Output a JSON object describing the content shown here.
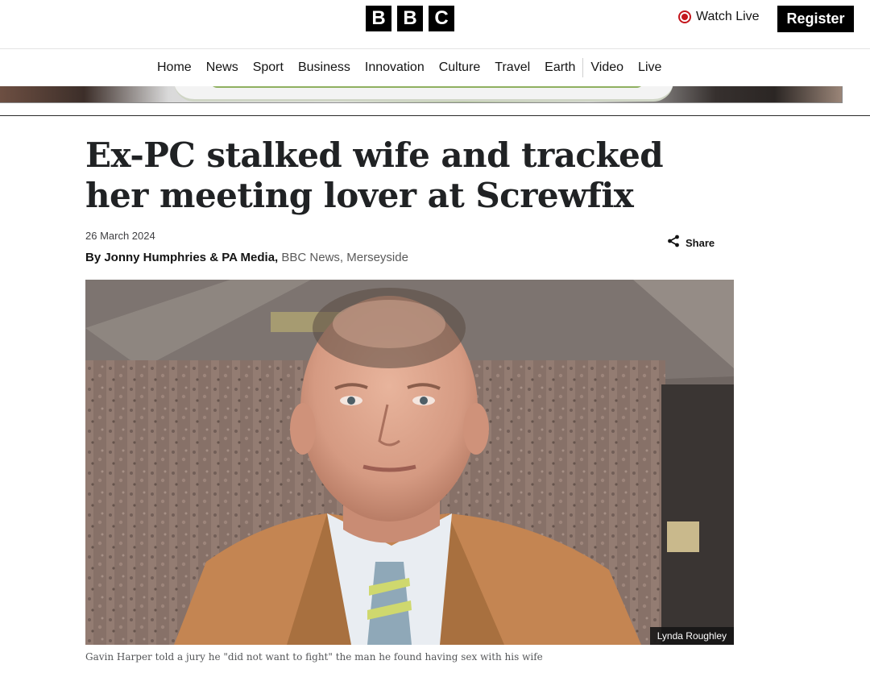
{
  "header": {
    "logo_letters": [
      "B",
      "B",
      "C"
    ],
    "watch_live_label": "Watch Live",
    "register_label": "Register"
  },
  "nav": {
    "items": [
      "Home",
      "News",
      "Sport",
      "Business",
      "Innovation",
      "Culture",
      "Travel",
      "Earth",
      "Video",
      "Live"
    ]
  },
  "article": {
    "headline": "Ex-PC stalked wife and tracked her meeting lover at Screwfix",
    "date": "26 March 2024",
    "byline_authors": "By Jonny Humphries & PA Media,",
    "byline_org": "BBC News, Merseyside",
    "share_label": "Share",
    "image_credit": "Lynda Roughley",
    "image_caption": "Gavin Harper told a jury he \"did not want to fight\" the man he found having sex with his wife"
  },
  "icons": {
    "live": "live-dot-icon",
    "share": "share-icon"
  },
  "colors": {
    "brand_black": "#000000",
    "live_red": "#c4161c"
  }
}
